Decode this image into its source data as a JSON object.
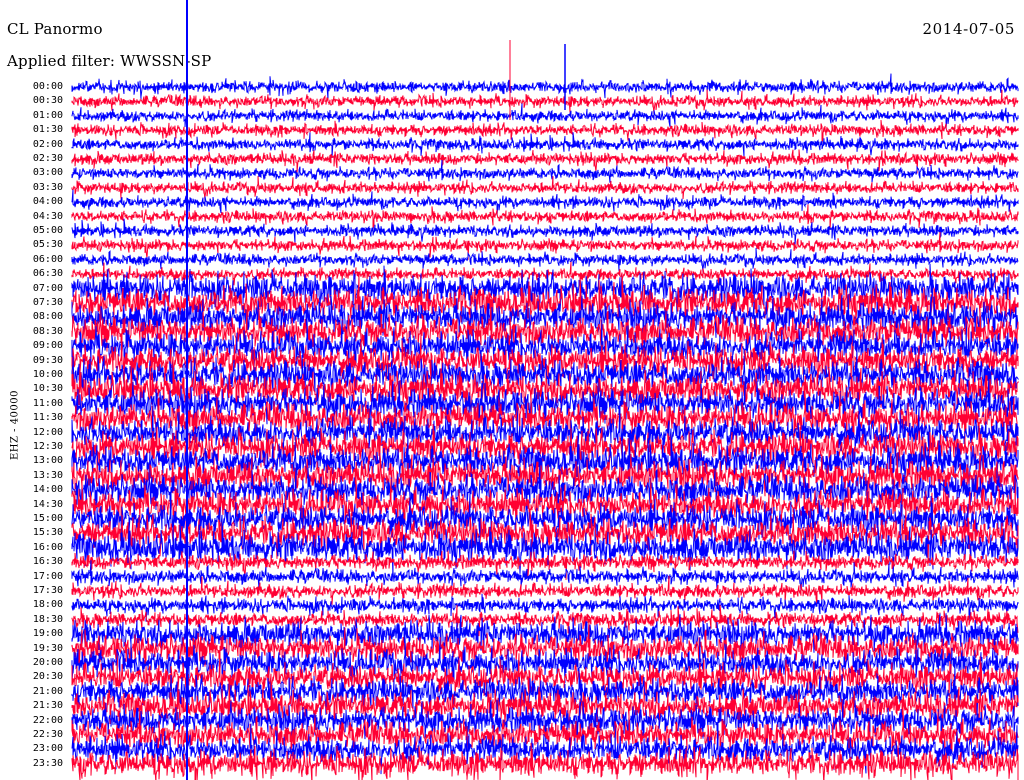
{
  "header": {
    "station": "CL Panormo",
    "date": "2014-07-05",
    "filter": "Applied filter: WWSSN-SP"
  },
  "channel_label": "EHZ - 40000",
  "time_labels": [
    "00:00",
    "00:30",
    "01:00",
    "01:30",
    "02:00",
    "02:30",
    "03:00",
    "03:30",
    "04:00",
    "04:30",
    "05:00",
    "05:30",
    "06:00",
    "06:30",
    "07:00",
    "07:30",
    "08:00",
    "08:30",
    "09:00",
    "09:30",
    "10:00",
    "10:30",
    "11:00",
    "11:30",
    "12:00",
    "12:30",
    "13:00",
    "13:30",
    "14:00",
    "14:30",
    "15:00",
    "15:30",
    "16:00",
    "16:30",
    "17:00",
    "17:30",
    "18:00",
    "18:30",
    "19:00",
    "19:30",
    "20:00",
    "20:30",
    "21:00",
    "21:30",
    "22:00",
    "22:30",
    "23:00",
    "23:30"
  ],
  "colors": {
    "trace_a": "#0000ff",
    "trace_b": "#ff0033",
    "background": "#ffffff",
    "text": "#000000"
  }
}
